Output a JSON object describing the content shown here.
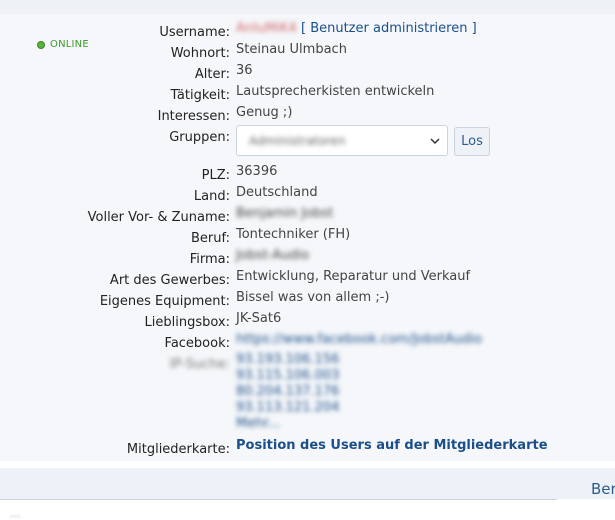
{
  "status": {
    "online": "ONLINE"
  },
  "profile": {
    "username_label": "Username:",
    "username_value": "AnIuMiK4",
    "admin_link": "[ Benutzer administrieren ]",
    "wohnort_label": "Wohnort:",
    "wohnort_value": "Steinau Ulmbach",
    "alter_label": "Alter:",
    "alter_value": "36",
    "taetigkeit_label": "Tätigkeit:",
    "taetigkeit_value": "Lautsprecherkisten entwickeln",
    "interessen_label": "Interessen:",
    "interessen_value": "Genug ;)",
    "gruppen_label": "Gruppen:",
    "gruppen_selected": "Administratoren",
    "los_button": "Los",
    "plz_label": "PLZ:",
    "plz_value": "36396",
    "land_label": "Land:",
    "land_value": "Deutschland",
    "name_label": "Voller Vor- & Zuname:",
    "name_value": "Benjamin Jobst",
    "beruf_label": "Beruf:",
    "beruf_value": "Tontechniker (FH)",
    "firma_label": "Firma:",
    "firma_value": "Jobst-Audio",
    "gewerbe_label": "Art des Gewerbes:",
    "gewerbe_value": "Entwicklung, Reparatur und Verkauf",
    "equipment_label": "Eigenes Equipment:",
    "equipment_value": "Bissel was von allem ;-)",
    "box_label": "Lieblingsbox:",
    "box_value": "JK-Sat6",
    "facebook_label": "Facebook:",
    "facebook_value": "https://www.facebook.com/JobstAudio",
    "ip_label": "IP-Suche:",
    "ip_values": [
      "93.193.106.156",
      "93.115.106.003",
      "80.204.137.176",
      "93.113.121.204",
      "Mehr..."
    ],
    "karte_label": "Mitgliederkarte:",
    "karte_link": "Position des Users auf der Mitgliederkarte"
  },
  "footer": {
    "ber": "Ber",
    "ghost": "..."
  },
  "colors": {
    "link": "#1c4f8a",
    "online": "#3a9a25",
    "panel": "#f5f7fa"
  },
  "icons": {
    "select_chevron": "chevron-down-icon",
    "online_dot": "status-dot-icon"
  }
}
